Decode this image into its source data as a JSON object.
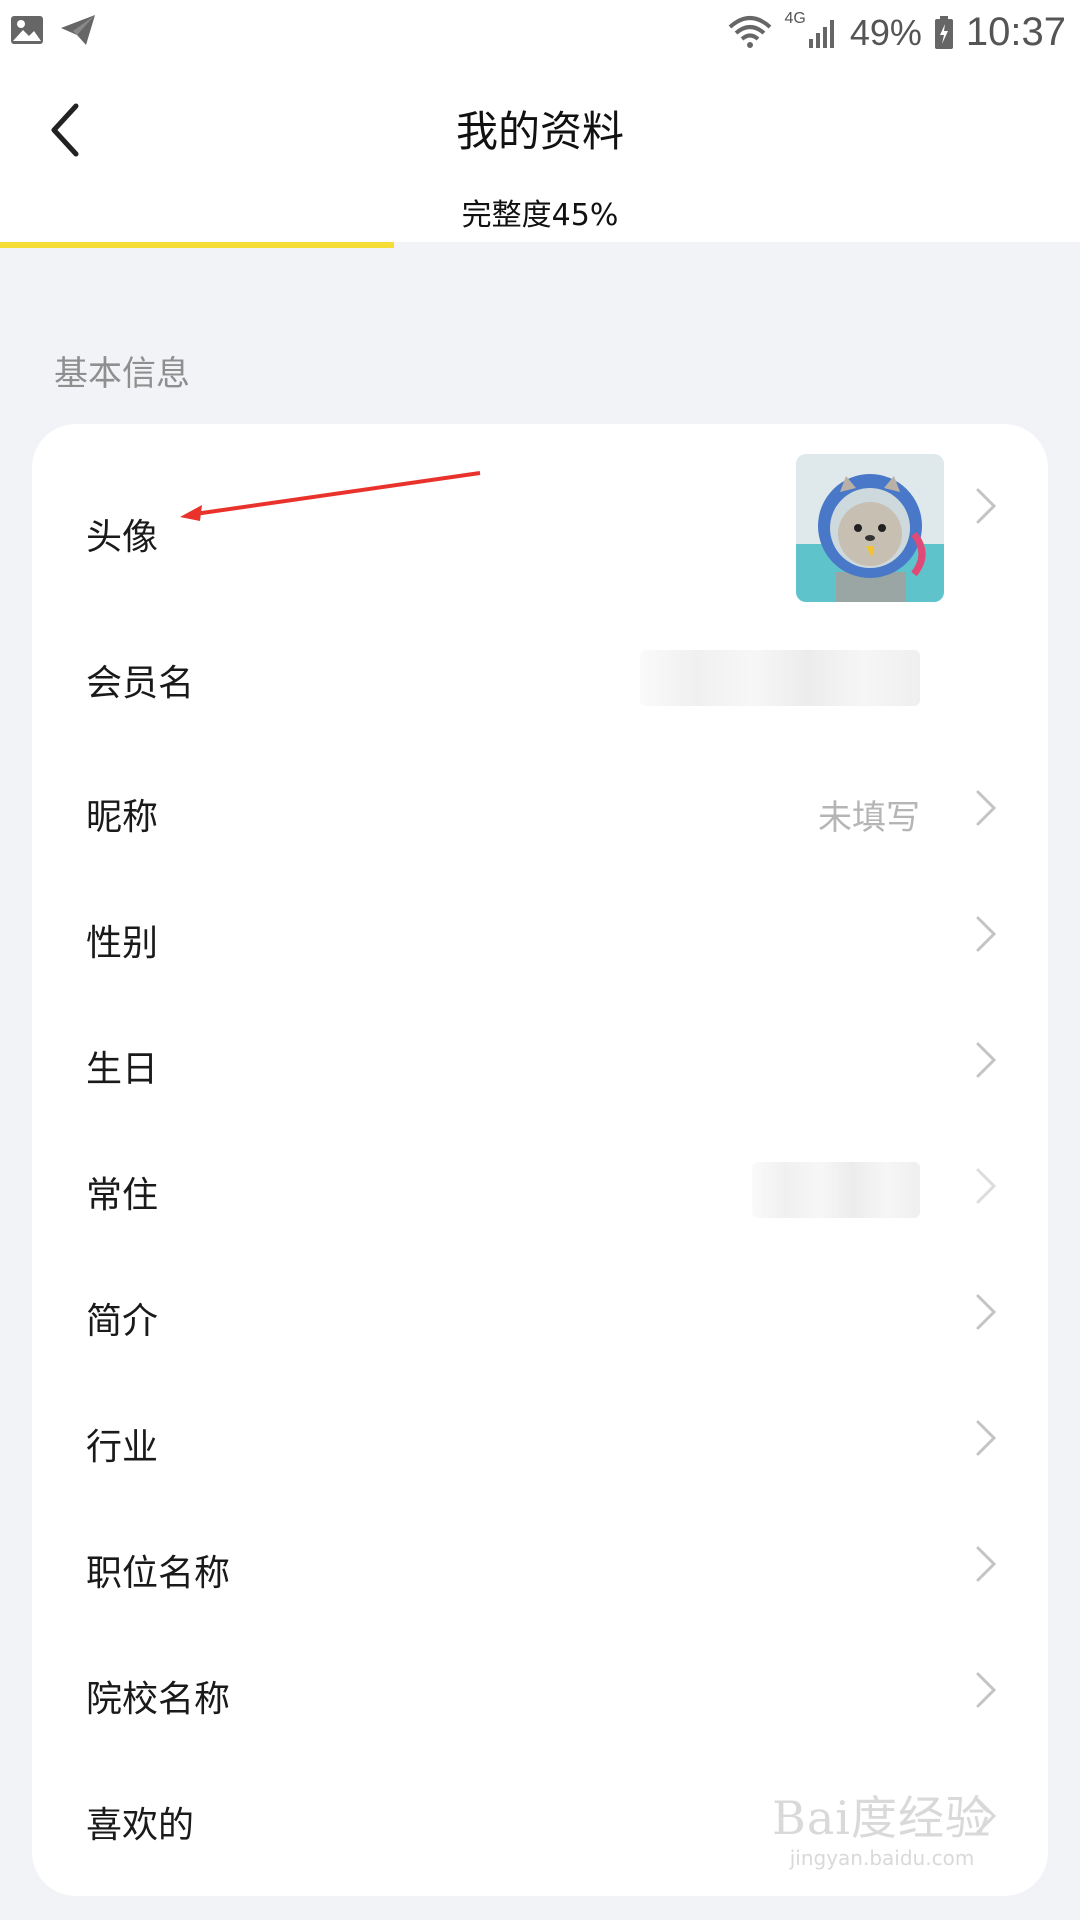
{
  "status_bar": {
    "battery": "49%",
    "time": "10:37",
    "network": "4G",
    "icons": [
      "gallery-icon",
      "send-icon",
      "wifi-icon",
      "signal-icon",
      "battery-icon"
    ]
  },
  "header": {
    "back_icon": "chevron-left-icon",
    "title": "我的资料",
    "completeness_text": "完整度45%",
    "completeness_percent": 45,
    "accent_color": "#f5dc36"
  },
  "section": {
    "label": "基本信息"
  },
  "rows": [
    {
      "label": "头像",
      "value": "",
      "type": "avatar"
    },
    {
      "label": "会员名",
      "value": "",
      "type": "blurred"
    },
    {
      "label": "昵称",
      "value": "未填写",
      "type": "text"
    },
    {
      "label": "性别",
      "value": "",
      "type": "text"
    },
    {
      "label": "生日",
      "value": "",
      "type": "text"
    },
    {
      "label": "常住",
      "value": "",
      "type": "blurred"
    },
    {
      "label": "简介",
      "value": "",
      "type": "text"
    },
    {
      "label": "行业",
      "value": "",
      "type": "text"
    },
    {
      "label": "职位名称",
      "value": "",
      "type": "text"
    },
    {
      "label": "院校名称",
      "value": "",
      "type": "text"
    },
    {
      "label": "喜欢的",
      "value": "",
      "type": "text"
    }
  ],
  "watermark": {
    "main": "Bai度经验",
    "sub": "jingyan.baidu.com"
  }
}
